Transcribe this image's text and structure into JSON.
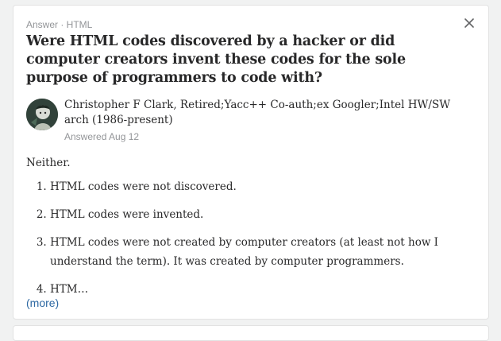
{
  "answer_card": {
    "meta": "Answer · HTML",
    "question_title": "Were HTML codes discovered by a hacker or did computer creators invent these codes for the sole purpose of programmers to code with?",
    "author": {
      "name": "Christopher F Clark",
      "credentials": ", Retired;Yacc++ Co-auth;ex Googler;Intel HW/SW arch (1986-present)",
      "answered": "Answered Aug 12"
    },
    "body": {
      "intro": "Neither.",
      "items": [
        "HTML codes were not discovered.",
        "HTML codes were invented.",
        "HTML codes were not created by computer creators (at least not how I understand the term). It was created by computer programmers.",
        "HTM…"
      ]
    },
    "more_link": "(more)",
    "close_icon": "close-icon",
    "colors": {
      "link": "#2e69a3",
      "muted": "#939598",
      "text": "#282829"
    }
  }
}
